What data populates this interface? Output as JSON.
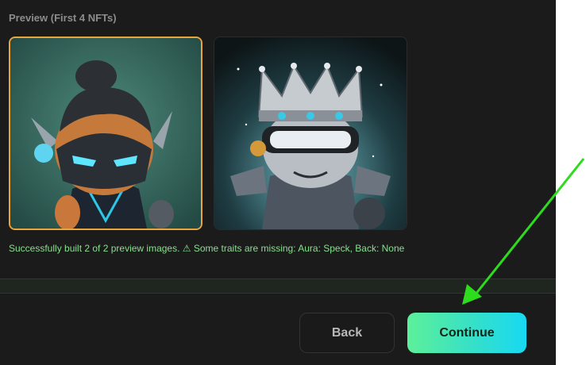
{
  "preview": {
    "title": "Preview (First 4 NFTs)",
    "images": [
      {
        "alt": "NFT preview 1",
        "selected": true
      },
      {
        "alt": "NFT preview 2",
        "selected": false
      }
    ],
    "status_message": "Successfully built 2 of 2 preview images. ⚠ Some traits are missing: Aura: Speck, Back: None"
  },
  "actions": {
    "back_label": "Back",
    "continue_label": "Continue"
  },
  "colors": {
    "background": "#1b1b1c",
    "selected_border": "#e7a53c",
    "status_text": "#86e08c",
    "continue_gradient_start": "#5df09a",
    "continue_gradient_end": "#17d9f3",
    "annotation_arrow": "#2ddc1c"
  },
  "annotation": {
    "icon": "green-pointer-arrow-icon"
  }
}
